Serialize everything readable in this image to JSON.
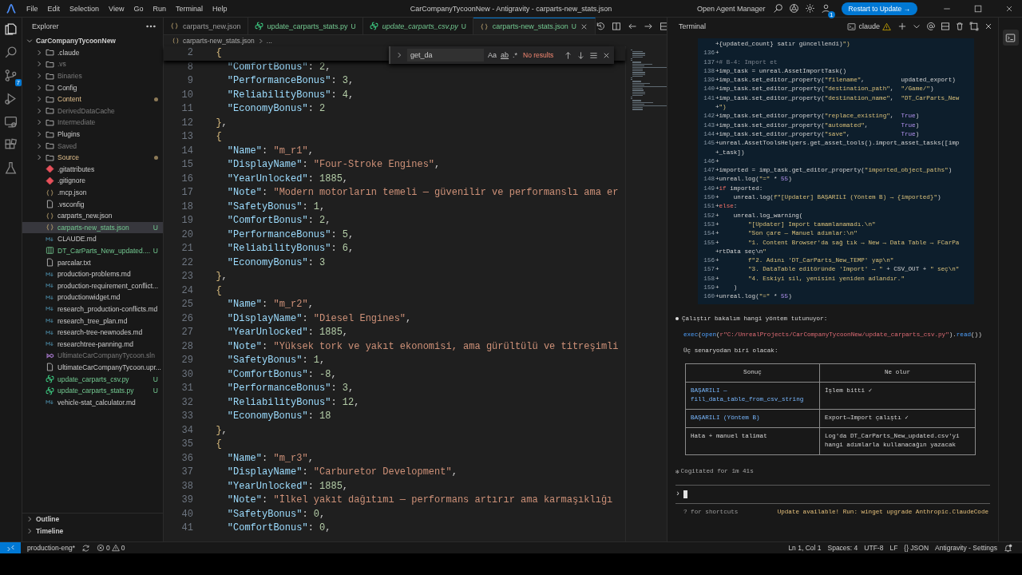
{
  "title_bar": {
    "menu": [
      "File",
      "Edit",
      "Selection",
      "View",
      "Go",
      "Run",
      "Terminal",
      "Help"
    ],
    "title": "CarCompanyTycoonNew - Antigravity - carparts-new_stats.json",
    "agent_manager": "Open Agent Manager",
    "account_badge": "1",
    "update_button": "Restart to Update →"
  },
  "activity_bar": {
    "items": [
      {
        "kind": "explorer",
        "selected": true
      },
      {
        "kind": "search",
        "selected": false
      },
      {
        "kind": "source-control",
        "selected": false,
        "badge": "7"
      },
      {
        "kind": "run",
        "selected": false
      },
      {
        "kind": "remote",
        "selected": false
      },
      {
        "kind": "extensions",
        "selected": false
      },
      {
        "kind": "testing",
        "selected": false
      }
    ]
  },
  "sidebar": {
    "title": "Explorer",
    "tree": {
      "label": "CarCompanyTycoonNew",
      "expanded": true,
      "children": [
        {
          "label": ".claude",
          "kind": "folder",
          "expanded": false,
          "dimmed": false,
          "modified": false
        },
        {
          "label": ".vs",
          "kind": "folder",
          "expanded": false,
          "dimmed": true,
          "modified": false
        },
        {
          "label": "Binaries",
          "kind": "folder",
          "expanded": false,
          "dimmed": true,
          "modified": false
        },
        {
          "label": "Config",
          "kind": "folder",
          "expanded": false,
          "dimmed": false,
          "modified": false
        },
        {
          "label": "Content",
          "kind": "folder",
          "expanded": false,
          "dimmed": false,
          "modified": true
        },
        {
          "label": "DerivedDataCache",
          "kind": "folder",
          "expanded": false,
          "dimmed": true,
          "modified": false
        },
        {
          "label": "Intermediate",
          "kind": "folder",
          "expanded": false,
          "dimmed": true,
          "modified": false
        },
        {
          "label": "Plugins",
          "kind": "folder",
          "expanded": false,
          "dimmed": false,
          "modified": false
        },
        {
          "label": "Saved",
          "kind": "folder",
          "expanded": false,
          "dimmed": true,
          "modified": false
        },
        {
          "label": "Source",
          "kind": "folder",
          "expanded": false,
          "dimmed": false,
          "modified": true
        },
        {
          "label": ".gitattributes",
          "kind": "git",
          "untracked": false,
          "dimmed": false,
          "selected": false
        },
        {
          "label": ".gitignore",
          "kind": "git",
          "untracked": false,
          "dimmed": false,
          "selected": false
        },
        {
          "label": ".mcp.json",
          "kind": "json",
          "untracked": false,
          "dimmed": false,
          "selected": false
        },
        {
          "label": ".vsconfig",
          "kind": "file",
          "untracked": false,
          "dimmed": false,
          "selected": false
        },
        {
          "label": "carparts_new.json",
          "kind": "json",
          "untracked": false,
          "dimmed": false,
          "selected": false
        },
        {
          "label": "carparts-new_stats.json",
          "kind": "json",
          "untracked": true,
          "badge": "U",
          "dimmed": false,
          "selected": true
        },
        {
          "label": "CLAUDE.md",
          "kind": "md",
          "untracked": false,
          "dimmed": false,
          "selected": false
        },
        {
          "label": "DT_CarParts_New_updated....",
          "kind": "csv",
          "untracked": true,
          "badge": "U",
          "dimmed": false,
          "selected": false
        },
        {
          "label": "parcalar.txt",
          "kind": "file",
          "untracked": false,
          "dimmed": false,
          "selected": false
        },
        {
          "label": "production-problems.md",
          "kind": "md",
          "untracked": false,
          "dimmed": false,
          "selected": false
        },
        {
          "label": "production-requirement_conflict...",
          "kind": "md",
          "untracked": false,
          "dimmed": false,
          "selected": false
        },
        {
          "label": "productionwidget.md",
          "kind": "md",
          "untracked": false,
          "dimmed": false,
          "selected": false
        },
        {
          "label": "research_production-conflicts.md",
          "kind": "md",
          "untracked": false,
          "dimmed": false,
          "selected": false
        },
        {
          "label": "research_tree_plan.md",
          "kind": "md",
          "untracked": false,
          "dimmed": false,
          "selected": false
        },
        {
          "label": "research-tree-newnodes.md",
          "kind": "md",
          "untracked": false,
          "dimmed": false,
          "selected": false
        },
        {
          "label": "researchtree-panning.md",
          "kind": "md",
          "untracked": false,
          "dimmed": false,
          "selected": false
        },
        {
          "label": "UltimateCarCompanyTycoon.sln",
          "kind": "sln",
          "untracked": false,
          "dimmed": true,
          "selected": false
        },
        {
          "label": "UltimateCarCompanyTycoon.upr...",
          "kind": "file",
          "untracked": false,
          "dimmed": false,
          "selected": false
        },
        {
          "label": "update_carparts_csv.py",
          "kind": "py",
          "untracked": true,
          "badge": "U",
          "dimmed": false,
          "selected": false
        },
        {
          "label": "update_carparts_stats.py",
          "kind": "py",
          "untracked": true,
          "badge": "U",
          "dimmed": false,
          "selected": false
        },
        {
          "label": "vehicle-stat_calculator.md",
          "kind": "md",
          "untracked": false,
          "dimmed": false,
          "selected": false
        }
      ]
    },
    "sections": [
      {
        "label": "Outline",
        "expanded": false
      },
      {
        "label": "Timeline",
        "expanded": false
      }
    ]
  },
  "editor": {
    "tabs": [
      {
        "label": "carparts_new.json",
        "kind": "json",
        "selected": false,
        "preview": false,
        "untracked": false
      },
      {
        "label": "update_carparts_stats.py",
        "kind": "py",
        "selected": false,
        "preview": false,
        "untracked": true,
        "badge": "U"
      },
      {
        "label": "update_carparts_csv.py",
        "kind": "py",
        "selected": false,
        "preview": true,
        "untracked": true,
        "badge": "U"
      },
      {
        "label": "carparts-new_stats.json",
        "kind": "json",
        "selected": true,
        "preview": false,
        "untracked": true,
        "badge": "U"
      }
    ],
    "breadcrumb": [
      "carparts-new_stats.json",
      "..."
    ],
    "find": {
      "value": "get_da",
      "options": [
        "Aa",
        "ab",
        ".*"
      ],
      "result": "No results"
    },
    "lines": [
      {
        "num": "2",
        "text": "  {",
        "sticky": true
      },
      {
        "num": "8",
        "text": "    \"ComfortBonus\": 2,"
      },
      {
        "num": "9",
        "text": "    \"PerformanceBonus\": 3,"
      },
      {
        "num": "10",
        "text": "    \"ReliabilityBonus\": 4,"
      },
      {
        "num": "11",
        "text": "    \"EconomyBonus\": 2"
      },
      {
        "num": "12",
        "text": "  },"
      },
      {
        "num": "13",
        "text": "  {"
      },
      {
        "num": "14",
        "text": "    \"Name\": \"m_r1\","
      },
      {
        "num": "15",
        "text": "    \"DisplayName\": \"Four-Stroke Engines\","
      },
      {
        "num": "16",
        "text": "    \"YearUnlocked\": 1885,"
      },
      {
        "num": "17",
        "text": "    \"Note\": \"Modern motorların temeli — güvenilir ve performanslı ama er"
      },
      {
        "num": "18",
        "text": "    \"SafetyBonus\": 1,"
      },
      {
        "num": "19",
        "text": "    \"ComfortBonus\": 2,"
      },
      {
        "num": "20",
        "text": "    \"PerformanceBonus\": 5,"
      },
      {
        "num": "21",
        "text": "    \"ReliabilityBonus\": 6,"
      },
      {
        "num": "22",
        "text": "    \"EconomyBonus\": 3"
      },
      {
        "num": "23",
        "text": "  },"
      },
      {
        "num": "24",
        "text": "  {"
      },
      {
        "num": "25",
        "text": "    \"Name\": \"m_r2\","
      },
      {
        "num": "26",
        "text": "    \"DisplayName\": \"Diesel Engines\","
      },
      {
        "num": "27",
        "text": "    \"YearUnlocked\": 1885,"
      },
      {
        "num": "28",
        "text": "    \"Note\": \"Yüksek tork ve yakıt ekonomisi, ama gürültülü ve titreşimli"
      },
      {
        "num": "29",
        "text": "    \"SafetyBonus\": 1,"
      },
      {
        "num": "30",
        "text": "    \"ComfortBonus\": -8,"
      },
      {
        "num": "31",
        "text": "    \"PerformanceBonus\": 3,"
      },
      {
        "num": "32",
        "text": "    \"ReliabilityBonus\": 12,"
      },
      {
        "num": "33",
        "text": "    \"EconomyBonus\": 18"
      },
      {
        "num": "34",
        "text": "  },"
      },
      {
        "num": "35",
        "text": "  {"
      },
      {
        "num": "36",
        "text": "    \"Name\": \"m_r3\","
      },
      {
        "num": "37",
        "text": "    \"DisplayName\": \"Carburetor Development\","
      },
      {
        "num": "38",
        "text": "    \"YearUnlocked\": 1885,"
      },
      {
        "num": "39",
        "text": "    \"Note\": \"İlkel yakıt dağıtımı — performans artırır ama karmaşıklığı"
      },
      {
        "num": "40",
        "text": "    \"SafetyBonus\": 0,"
      },
      {
        "num": "41",
        "text": "    \"ComfortBonus\": 0,"
      }
    ]
  },
  "terminal_panel": {
    "title": "Terminal",
    "session": "claude",
    "diff": [
      {
        "text": "+{updated_count} satır güncellendi)\")"
      },
      {
        "num": "136",
        "text": "+"
      },
      {
        "num": "137",
        "text": "+# B-4: Import et"
      },
      {
        "num": "138",
        "text": "+imp_task = unreal.AssetImportTask()"
      },
      {
        "num": "139",
        "text": "+imp_task.set_editor_property(\"filename\",          updated_export)"
      },
      {
        "num": "140",
        "text": "+imp_task.set_editor_property(\"destination_path\",  \"/Game/\")"
      },
      {
        "num": "141",
        "text": "+imp_task.set_editor_property(\"destination_name\",  \"DT_CarParts_New"
      },
      {
        "text": "+\")"
      },
      {
        "num": "142",
        "text": "+imp_task.set_editor_property(\"replace_existing\",  True)"
      },
      {
        "num": "143",
        "text": "+imp_task.set_editor_property(\"automated\",         True)"
      },
      {
        "num": "144",
        "text": "+imp_task.set_editor_property(\"save\",              True)"
      },
      {
        "num": "145",
        "text": "+unreal.AssetToolsHelpers.get_asset_tools().import_asset_tasks([imp"
      },
      {
        "text": "+_task])"
      },
      {
        "num": "146",
        "text": "+"
      },
      {
        "num": "147",
        "text": "+imported = imp_task.get_editor_property(\"imported_object_paths\")"
      },
      {
        "num": "148",
        "text": "+unreal.log(\"=\" * 55)"
      },
      {
        "num": "149",
        "text": "+if imported:"
      },
      {
        "num": "150",
        "text": "+    unreal.log(f\"[Updater] BAŞARILI (Yöntem B) → {imported}\")"
      },
      {
        "num": "151",
        "text": "+else:"
      },
      {
        "num": "152",
        "text": "+    unreal.log_warning("
      },
      {
        "num": "153",
        "text": "+        \"[Updater] Import tamamlanamadı.\\n\""
      },
      {
        "num": "154",
        "text": "+        \"Son çare — Manuel adımlar:\\n\""
      },
      {
        "num": "155",
        "text": "+        \"1. Content Browser'da sağ tık → New → Data Table → FCarPa"
      },
      {
        "text": "+rtData seç\\n\""
      },
      {
        "num": "156",
        "text": "+        f\"2. Adını 'DT_CarParts_New_TEMP' yap\\n\""
      },
      {
        "num": "157",
        "text": "+        \"3. DataTable editöründe 'Import' → \" + CSV_OUT + \" seç\\n\""
      },
      {
        "num": "158",
        "text": "+        \"4. Eskiyi sil, yenisini yeniden adlandır.\""
      },
      {
        "num": "159",
        "text": "+    )"
      },
      {
        "num": "160",
        "text": "+unreal.log(\"=\" * 55)"
      }
    ],
    "message": "Çalıştır bakalım hangi yöntem tutunuyor:",
    "command": "exec(open(r\"C:/UnrealProjects/CarCompanyTycoonNew/update_carparts_csv.py\").read())",
    "intro": "Üç senaryodan biri olacak:",
    "table": {
      "columns": [
        "Sonuç",
        "Ne olur"
      ],
      "rows": [
        {
          "success": true,
          "cells": [
            "BAŞARILI — fill_data_table_from_csv_string",
            "İşlem bitti ✓"
          ]
        },
        {
          "success": true,
          "cells": [
            "BAŞARILI (Yöntem B)",
            "Export→Import çalıştı ✓"
          ]
        },
        {
          "success": false,
          "cells": [
            "Hata + manuel talimat",
            "Log'da DT_CarParts_New_updated.csv'yi hangi adımlarla kullanacağın yazacak"
          ]
        }
      ]
    },
    "thinking": {
      "glyph": "✻",
      "text": "Cogitated for 1m 41s"
    },
    "prompt": "›",
    "shortcuts_hint": "? for shortcuts",
    "update_notice": "Update available! Run: winget upgrade Anthropic.ClaudeCode"
  },
  "status_bar": {
    "branch": "production-eng*",
    "errors": "0",
    "warnings": "0",
    "items": [
      "Ln 1, Col 1",
      "Spaces: 4",
      "UTF-8",
      "LF",
      "{} JSON",
      "Antigravity - Settings"
    ]
  }
}
